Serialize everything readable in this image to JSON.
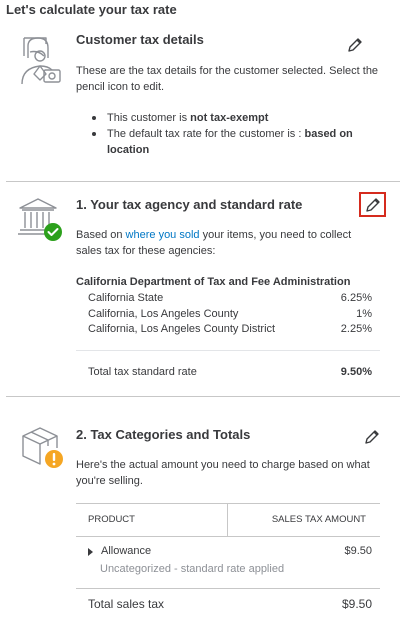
{
  "header": {
    "title": "Let's calculate your tax rate"
  },
  "customer_section": {
    "title": "Customer tax details",
    "icon": "customer-id-icon",
    "description": "These are the tax details for the customer selected. Select the pencil icon to edit.",
    "bullet1_prefix": "This customer is ",
    "bullet1_bold": "not tax-exempt",
    "bullet2_prefix": "The default tax rate for the customer is : ",
    "bullet2_bold": "based on location"
  },
  "agency_section": {
    "title": "1. Your tax agency and standard rate",
    "icon": "tax-agency-building-icon",
    "status_icon": "check-circle-icon",
    "desc_prefix": "Based on ",
    "desc_link": "where you sold",
    "desc_suffix": " your items, you need to collect sales tax for these agencies:",
    "agency_name": "California Department of Tax and Fee Administration",
    "rates": [
      {
        "name": "California State",
        "value": "6.25%"
      },
      {
        "name": "California, Los Angeles County",
        "value": "1%"
      },
      {
        "name": "California, Los Angeles County District",
        "value": "2.25%"
      }
    ],
    "total_label": "Total tax standard rate",
    "total_value": "9.50%"
  },
  "categories_section": {
    "title": "2. Tax Categories and Totals",
    "icon": "package-box-icon",
    "status_icon": "warning-circle-icon",
    "description": "Here's the actual amount you need to charge based on what you're selling.",
    "table": {
      "columns": [
        "PRODUCT",
        "SALES TAX AMOUNT"
      ],
      "rows": [
        {
          "name": "Allowance",
          "amount": "$9.50",
          "subtext": "Uncategorized - standard rate applied"
        }
      ]
    },
    "total_label": "Total sales tax",
    "total_value": "$9.50"
  },
  "colors": {
    "link": "#0077c5",
    "success": "#2ca01c",
    "warning": "#f5a623",
    "highlight": "#d52b1e"
  }
}
